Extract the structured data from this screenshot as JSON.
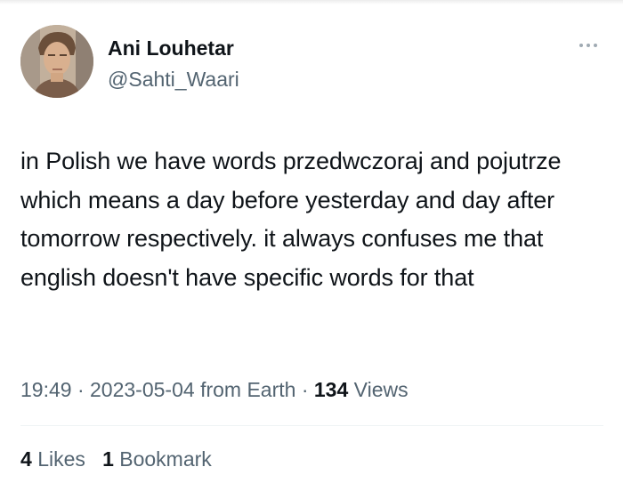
{
  "author": {
    "display_name": "Ani Louhetar",
    "handle": "@Sahti_Waari",
    "avatar_icon": "profile-photo"
  },
  "menu": {
    "icon": "more-dots-icon"
  },
  "tweet": {
    "text": "in Polish we have words przedwczoraj and pojutrze which means a day before yesterday and day after tomorrow respectively. it always confuses me that english doesn't have specific words for that"
  },
  "meta": {
    "time": "19:49",
    "separator": "·",
    "date": "2023-05-04",
    "source": "from Earth",
    "views_count": "134",
    "views_label": "Views"
  },
  "stats": {
    "likes_count": "4",
    "likes_label": "Likes",
    "bookmarks_count": "1",
    "bookmarks_label": "Bookmark"
  },
  "colors": {
    "text_primary": "#0f1419",
    "text_secondary": "#536471",
    "divider": "#eff3f4"
  }
}
